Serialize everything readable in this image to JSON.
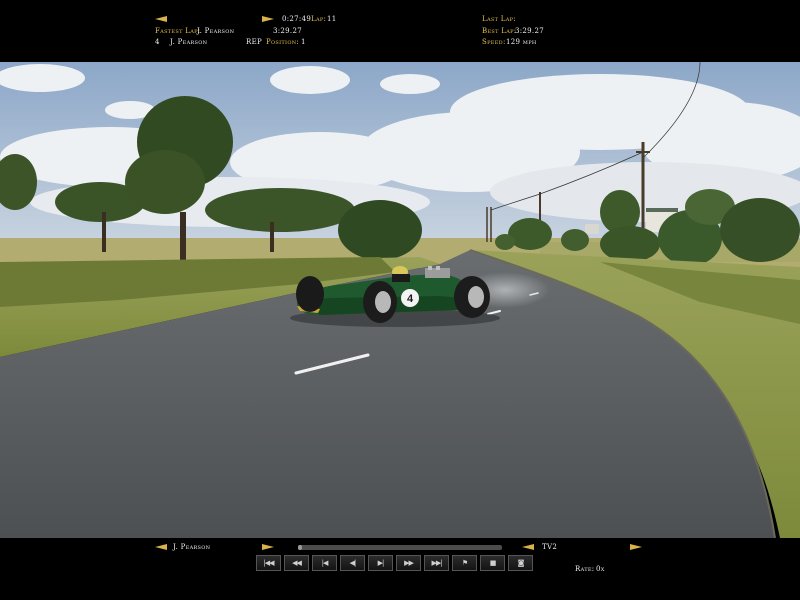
{
  "hud": {
    "elapsed_time": "0:27:49",
    "lap_label": "Lap:",
    "lap_value": "11",
    "fastest_lap_label": "Fastest Lap:",
    "fastest_lap_driver": "J. Pearson",
    "fastest_lap_time": "3:29.27",
    "driver_number": "4",
    "driver_name": "J. Pearson",
    "rep_label": "REP",
    "position_label": "Position:",
    "position_value": "1",
    "last_lap_label": "Last Lap:",
    "best_lap_label": "Best Lap:",
    "best_lap_value": "3:29.27",
    "speed_label": "Speed:",
    "speed_value": "129 mph"
  },
  "car": {
    "number": "4",
    "body_color": "#1f5a2f"
  },
  "replay": {
    "driver_name": "J. Pearson",
    "camera_name": "TV2",
    "rate_label": "Rate:",
    "rate_value": "0x",
    "progress": 0.02,
    "controls": [
      {
        "id": "skip-start",
        "glyph": "|◀◀",
        "icon": "skip-start-icon"
      },
      {
        "id": "rewind",
        "glyph": "◀◀",
        "icon": "rewind-icon"
      },
      {
        "id": "step-back",
        "glyph": "|◀",
        "icon": "step-back-icon"
      },
      {
        "id": "play-reverse",
        "glyph": "◀|",
        "icon": "play-reverse-icon"
      },
      {
        "id": "play",
        "glyph": "▶|",
        "icon": "play-icon"
      },
      {
        "id": "fast-forward",
        "glyph": "▶▶",
        "icon": "fast-forward-icon"
      },
      {
        "id": "skip-end",
        "glyph": "▶▶|",
        "icon": "skip-end-icon"
      },
      {
        "id": "mark",
        "glyph": "⚑",
        "icon": "flag-icon"
      },
      {
        "id": "stop",
        "glyph": "■",
        "icon": "stop-icon"
      },
      {
        "id": "camera",
        "glyph": "◙",
        "icon": "camera-icon"
      }
    ]
  },
  "colors": {
    "hud_label": "#e8c24a",
    "grass": "#7a8a3c",
    "asphalt": "#55585a",
    "sky": "#9fb7d4"
  }
}
